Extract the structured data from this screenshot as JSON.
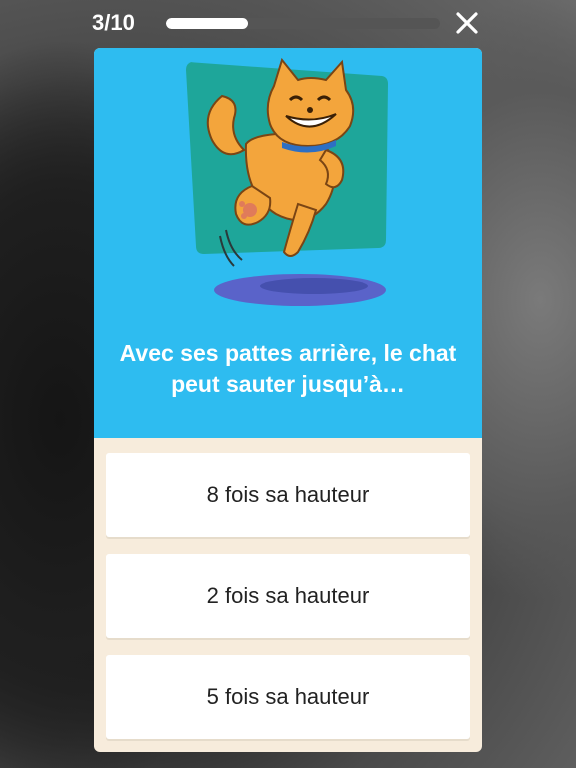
{
  "header": {
    "counter": "3/10",
    "progress": 0.3
  },
  "question": {
    "text": "Avec ses pattes arrière, le chat peut sauter jusqu’à…"
  },
  "answers": [
    {
      "label": "8 fois sa hauteur"
    },
    {
      "label": "2 fois sa hauteur"
    },
    {
      "label": "5 fois sa hauteur"
    }
  ],
  "colors": {
    "card_top": "#2ebcf0",
    "card_bottom": "#f7ecdc",
    "accent_panel": "#1ea69a",
    "cat_orange": "#f3a53c",
    "shadow_purple": "#5a63c9"
  },
  "icons": {
    "close": "close-icon",
    "illustration": "cat-jumping-illustration"
  }
}
